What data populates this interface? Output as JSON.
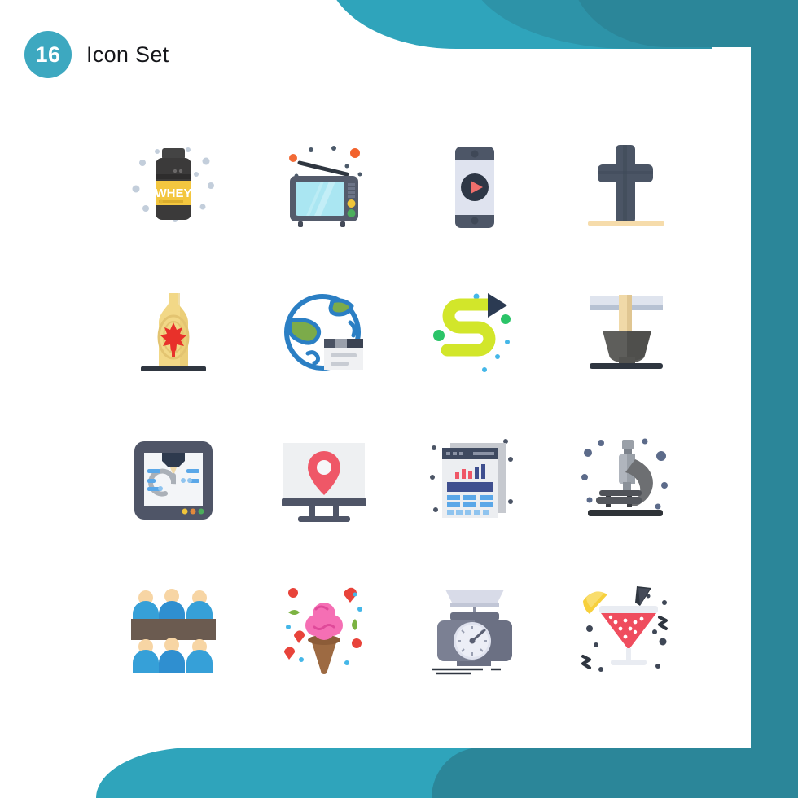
{
  "header": {
    "count": "16",
    "title": "Icon Set"
  },
  "colors": {
    "teal_light": "#2fa4bb",
    "teal_mid": "#2d93a8",
    "teal_dark": "#2b8699",
    "badge": "#3da8c0",
    "title_text": "#15161a",
    "page_background": "#ffffff"
  },
  "grid": {
    "columns": 4,
    "rows": 4,
    "total": 16
  },
  "icons": [
    {
      "index": 1,
      "name": "whey-protein-bottle-icon",
      "label": "Whey Protein",
      "row": 1,
      "col": 1,
      "primary_color": "#3b3a3a",
      "accent_color": "#f3c63f",
      "text_on_icon": "WHEY"
    },
    {
      "index": 2,
      "name": "retro-television-icon",
      "label": "Television",
      "row": 1,
      "col": 2,
      "primary_color": "#4f5565",
      "accent_color": "#aae6f2",
      "text_on_icon": ""
    },
    {
      "index": 3,
      "name": "mobile-video-player-icon",
      "label": "Mobile Video",
      "row": 1,
      "col": 3,
      "primary_color": "#4d5667",
      "accent_color": "#ef6f6c",
      "text_on_icon": ""
    },
    {
      "index": 4,
      "name": "christian-cross-icon",
      "label": "Cross",
      "row": 1,
      "col": 4,
      "primary_color": "#4b5565",
      "accent_color": "#f6dcab",
      "text_on_icon": ""
    },
    {
      "index": 5,
      "name": "maple-syrup-bottle-icon",
      "label": "Maple Syrup",
      "row": 2,
      "col": 1,
      "primary_color": "#f2d887",
      "accent_color": "#e8312a",
      "text_on_icon": ""
    },
    {
      "index": 6,
      "name": "globe-browser-icon",
      "label": "Global Web",
      "row": 2,
      "col": 2,
      "primary_color": "#2b7fc4",
      "accent_color": "#7cab4a",
      "text_on_icon": ""
    },
    {
      "index": 7,
      "name": "winding-path-arrow-icon",
      "label": "Route Path",
      "row": 2,
      "col": 3,
      "primary_color": "#d2e62a",
      "accent_color": "#2b3a52",
      "text_on_icon": ""
    },
    {
      "index": 8,
      "name": "mortar-pestle-icon",
      "label": "Mortar and Pestle",
      "row": 2,
      "col": 4,
      "primary_color": "#5e5e5b",
      "accent_color": "#f0d9a8",
      "text_on_icon": ""
    },
    {
      "index": 9,
      "name": "3d-printer-icon",
      "label": "3D Printer",
      "row": 3,
      "col": 1,
      "primary_color": "#4f5567",
      "accent_color": "#5aa7e8",
      "text_on_icon": ""
    },
    {
      "index": 10,
      "name": "monitor-location-pin-icon",
      "label": "Map Display",
      "row": 3,
      "col": 2,
      "primary_color": "#4f5567",
      "accent_color": "#ef5767",
      "text_on_icon": ""
    },
    {
      "index": 11,
      "name": "analytics-report-icon",
      "label": "Report",
      "row": 3,
      "col": 3,
      "primary_color": "#3f4f8f",
      "accent_color": "#5aa7e8",
      "text_on_icon": ""
    },
    {
      "index": 12,
      "name": "microscope-icon",
      "label": "Microscope",
      "row": 3,
      "col": 4,
      "primary_color": "#6d6f72",
      "accent_color": "#5c6b8a",
      "text_on_icon": ""
    },
    {
      "index": 13,
      "name": "audience-seating-icon",
      "label": "Audience",
      "row": 4,
      "col": 1,
      "primary_color": "#36a0d8",
      "accent_color": "#6b5b50",
      "text_on_icon": ""
    },
    {
      "index": 14,
      "name": "ice-cream-cone-icon",
      "label": "Ice Cream",
      "row": 4,
      "col": 2,
      "primary_color": "#f56fb4",
      "accent_color": "#9d6a42",
      "text_on_icon": ""
    },
    {
      "index": 15,
      "name": "kitchen-scale-icon",
      "label": "Kitchen Scale",
      "row": 4,
      "col": 3,
      "primary_color": "#6b7083",
      "accent_color": "#d8dbe8",
      "text_on_icon": ""
    },
    {
      "index": 16,
      "name": "cocktail-glass-icon",
      "label": "Cocktail",
      "row": 4,
      "col": 4,
      "primary_color": "#ef4d5e",
      "accent_color": "#f7d03c",
      "text_on_icon": ""
    }
  ]
}
